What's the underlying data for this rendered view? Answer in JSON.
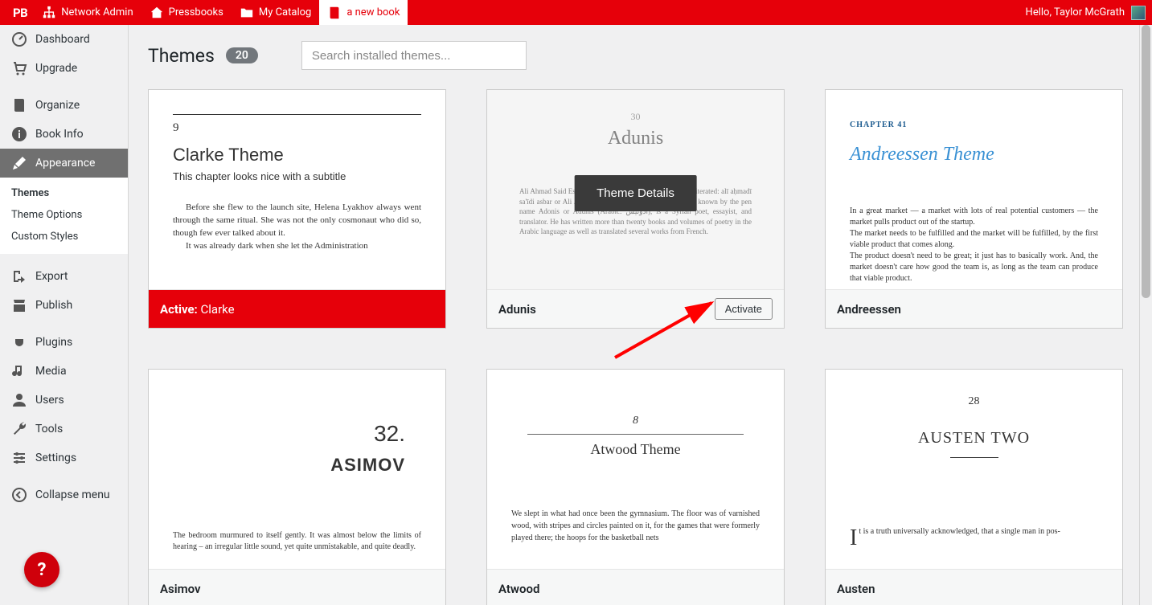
{
  "topbar": {
    "logo": "PB",
    "items": [
      {
        "label": "Network Admin",
        "icon": "sitemap"
      },
      {
        "label": "Pressbooks",
        "icon": "home"
      },
      {
        "label": "My Catalog",
        "icon": "folder"
      },
      {
        "label": "a new book",
        "icon": "book",
        "active": true
      }
    ],
    "greeting": "Hello, Taylor McGrath"
  },
  "sidebar": {
    "items": [
      {
        "label": "Dashboard",
        "icon": "gauge"
      },
      {
        "label": "Upgrade",
        "icon": "cart"
      },
      {
        "label": "Organize",
        "icon": "book-solid",
        "sep_before": true
      },
      {
        "label": "Book Info",
        "icon": "info"
      },
      {
        "label": "Appearance",
        "icon": "brush",
        "current": true,
        "submenu": [
          "Themes",
          "Theme Options",
          "Custom Styles"
        ],
        "submenu_current": 0
      },
      {
        "label": "Export",
        "icon": "export",
        "sep_before": true
      },
      {
        "label": "Publish",
        "icon": "shop"
      },
      {
        "label": "Plugins",
        "icon": "plug",
        "sep_before": true
      },
      {
        "label": "Media",
        "icon": "media"
      },
      {
        "label": "Users",
        "icon": "user"
      },
      {
        "label": "Tools",
        "icon": "wrench"
      },
      {
        "label": "Settings",
        "icon": "sliders"
      },
      {
        "label": "Collapse menu",
        "icon": "collapse",
        "sep_before": true
      }
    ]
  },
  "page": {
    "title": "Themes",
    "count": "20",
    "search_placeholder": "Search installed themes..."
  },
  "themes": [
    {
      "name": "Clarke",
      "active": true,
      "footer_prefix": "Active:",
      "preview": {
        "chapnum": "9",
        "title": "Clarke Theme",
        "subtitle": "This chapter looks nice with a subtitle",
        "p1": "Before she flew to the launch site, Helena Lyakhov always went through the same ritual. She was not the only cosmonaut who did so, though few ever talked about it.",
        "p2": "It was already dark when she let the Administration"
      }
    },
    {
      "name": "Adunis",
      "hovered": true,
      "details_label": "Theme Details",
      "activate_label": "Activate",
      "preview": {
        "chapnum": "30",
        "title": "Adunis",
        "body": "Ali Ahmad Said Esber (Arabic: علي أحمد سعيد إسبر; transliterated: alī aḥmadī sa'īdi asbar or Ali Ahmad Sa'id; born 1 January 1930), also known by the pen name Adonis or Adunis (Arabic: أدونيس), is a Syrian poet, essayist, and translator. He has written more than twenty books and volumes of poetry in the Arabic language as well as translated several works from French."
      }
    },
    {
      "name": "Andreessen",
      "preview": {
        "chaplabel": "CHAPTER 41",
        "title": "Andreessen Theme",
        "p1": "In a great market — a market with lots of real potential customers — the market pulls product out of the startup.",
        "p2": "The market needs to be fulfilled and the market will be fulfilled, by the first viable product that comes along.",
        "p3": "The product doesn't need to be great; it just has to basically work. And, the market doesn't care how good the team is, as long as the team can produce that viable product."
      }
    },
    {
      "name": "Asimov",
      "preview": {
        "chapnum": "32.",
        "title": "ASIMOV",
        "body": "The bedroom murmured to itself gently. It was almost below the limits of hearing – an irregular little sound, yet quite unmistakable, and quite deadly."
      }
    },
    {
      "name": "Atwood",
      "preview": {
        "chapnum": "8",
        "title": "Atwood Theme",
        "body": "We slept in what had once been the gymnasium. The floor was of varnished wood, with stripes and circles painted on it, for the games that were formerly played there; the hoops for the basketball nets"
      }
    },
    {
      "name": "Austen",
      "preview": {
        "chapnum": "28",
        "title": "AUSTEN TWO",
        "body": "t is a truth universally acknowledged, that a single man in pos-"
      }
    }
  ],
  "help_label": "?"
}
